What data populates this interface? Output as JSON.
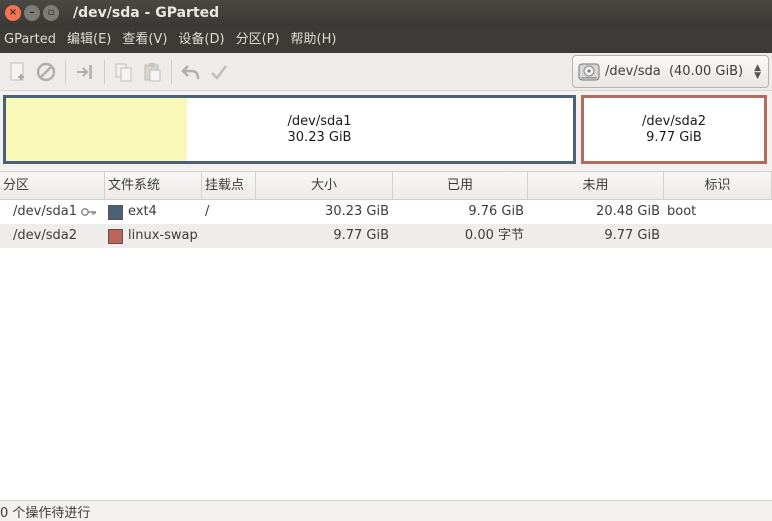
{
  "window": {
    "title": "/dev/sda - GParted"
  },
  "menubar": {
    "items": [
      "GParted",
      "编辑(E)",
      "查看(V)",
      "设备(D)",
      "分区(P)",
      "帮助(H)"
    ]
  },
  "toolbar": {
    "buttons": [
      "new-partition-icon",
      "delete-icon",
      "resize-move-icon",
      "copy-icon",
      "paste-icon",
      "undo-icon",
      "apply-icon"
    ],
    "device_selector": {
      "value": "/dev/sda  (40.00 GiB)",
      "icon": "hard-disk-icon"
    }
  },
  "visual": {
    "partitions": [
      {
        "name": "/dev/sda1",
        "size": "30.23 GiB",
        "used_fraction": 0.32,
        "border_color": "#4a6178",
        "used_color": "#f8f8b8"
      },
      {
        "name": "/dev/sda2",
        "size": "9.77 GiB",
        "border_color": "#b46a5c"
      }
    ]
  },
  "table": {
    "headers": [
      "分区",
      "文件系统",
      "挂载点",
      "大小",
      "已用",
      "未用",
      "标识"
    ],
    "rows": [
      {
        "partition": "/dev/sda1",
        "locked": true,
        "filesystem": "ext4",
        "fs_color": "#4a6178",
        "mountpoint": "/",
        "size": "30.23 GiB",
        "used": "9.76 GiB",
        "unused": "20.48 GiB",
        "flags": "boot"
      },
      {
        "partition": "/dev/sda2",
        "locked": false,
        "filesystem": "linux-swap",
        "fs_color": "#c0645a",
        "mountpoint": "",
        "size": "9.77 GiB",
        "used": "0.00 字节",
        "unused": "9.77 GiB",
        "flags": ""
      }
    ]
  },
  "statusbar": {
    "text": "0 个操作待进行"
  }
}
